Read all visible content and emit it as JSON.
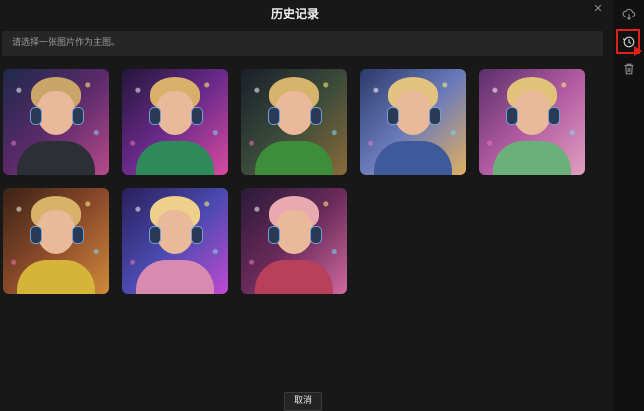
{
  "dialog": {
    "title": "历史记录",
    "instruction": "请选择一张图片作为主图。",
    "cancel_label": "取消",
    "close_icon": "close-icon"
  },
  "gallery": {
    "images": [
      {
        "alt": "anime boy with headphones, neon city lights",
        "bg": "#3a2a4a",
        "hair": "#c9a56a",
        "body": "#2d2f36"
      },
      {
        "alt": "anime boy with headphones, green jacket, purple neon",
        "bg": "#24163a",
        "hair": "#d9b06a",
        "body": "#2f8a5a"
      },
      {
        "alt": "anime boy with headphones, green hoodie, warm lights",
        "bg": "#1f2a2a",
        "hair": "#d6b46c",
        "body": "#3d8d3a"
      },
      {
        "alt": "anime boy with headphones, blue hoodie, bright lights",
        "bg": "#2b3a6a",
        "hair": "#e2c37f",
        "body": "#3e5a9a"
      },
      {
        "alt": "anime boy smiling with headphones, pink neon",
        "bg": "#5a2f6a",
        "hair": "#e0c27a",
        "body": "#6bb07a"
      },
      {
        "alt": "anime boy with headphones, yellow shirt, bokeh",
        "bg": "#3a2216",
        "hair": "#d9b26a",
        "body": "#d6b43a"
      },
      {
        "alt": "anime boy with headphones, pink jacket, laser lights",
        "bg": "#2a1f5a",
        "hair": "#efd08a",
        "body": "#d98ab0"
      },
      {
        "alt": "anime boy with headphones, red jacket, pink lights",
        "bg": "#4a1f3a",
        "hair": "#e8a9b0",
        "body": "#b8405a"
      }
    ]
  },
  "sidebar": {
    "buttons": [
      {
        "icon": "download-cloud-icon"
      },
      {
        "icon": "history-icon",
        "highlighted": true
      },
      {
        "icon": "trash-icon"
      }
    ]
  },
  "colors": {
    "background": "#181818",
    "highlight": "#e0201a"
  }
}
